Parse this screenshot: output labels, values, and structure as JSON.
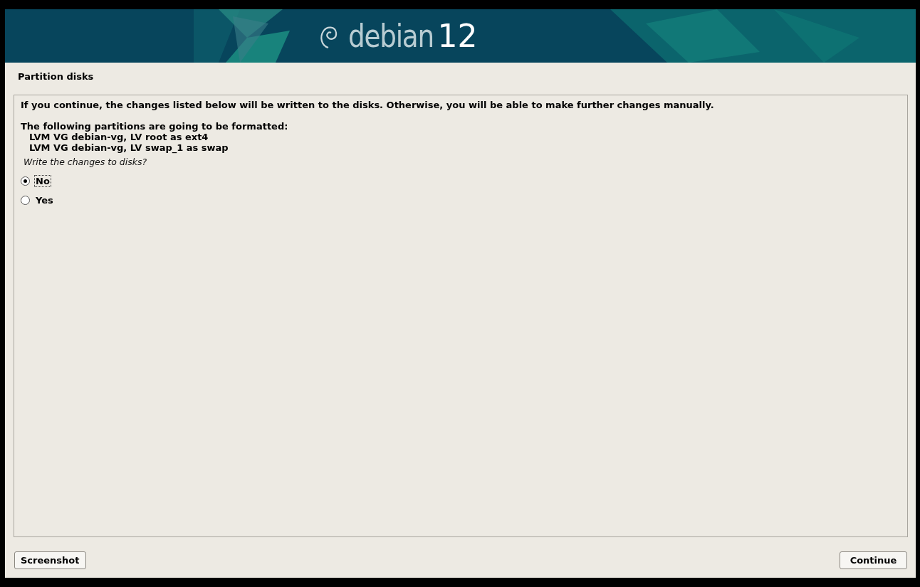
{
  "banner": {
    "logo_text": "debian",
    "version": "12"
  },
  "title": "Partition disks",
  "intro": "If you continue, the changes listed below will be written to the disks. Otherwise, you will be able to make further changes manually.",
  "heading": "The following partitions are going to be formatted:",
  "partitions": [
    "LVM VG debian-vg, LV root as ext4",
    "LVM VG debian-vg, LV swap_1 as swap"
  ],
  "question": "Write the changes to disks?",
  "options": [
    {
      "label": "No",
      "selected": true
    },
    {
      "label": "Yes",
      "selected": false
    }
  ],
  "buttons": {
    "left": "Screenshot",
    "right": "Continue"
  }
}
